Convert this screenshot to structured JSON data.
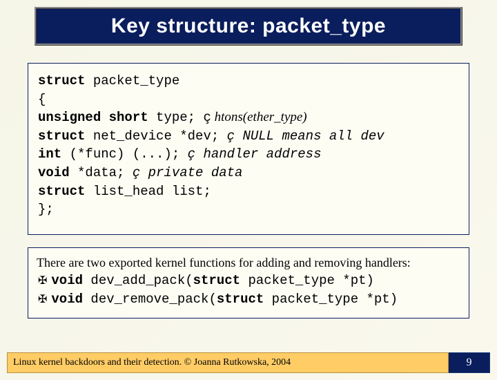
{
  "title": "Key structure: packet_type",
  "code": {
    "l1a": "struct",
    "l1b": " packet_type",
    "l2": "{",
    "l3a": " unsigned short",
    "l3b": "      type;  ",
    "l3c": "ç",
    "l3d": " htons(ether_type)",
    "l4a": " struct",
    "l4b": " net_device *dev;  ",
    "l4c": "ç NULL means all dev",
    "l5a": " int",
    "l5b": " (*func) (...); ",
    "l5c": "ç handler address",
    "l6a": " void",
    "l6b": " *data; ",
    "l6c": "ç private data",
    "l7a": " struct",
    "l7b": " list_head list;",
    "l8": "};"
  },
  "text": {
    "intro": "There are two exported kernel functions for adding and removing handlers:",
    "b1a": "void",
    "b1b": " dev_add_pack(",
    "b1c": "struct",
    "b1d": " packet_type *pt)",
    "b2a": "void",
    "b2b": " dev_remove_pack(",
    "b2c": "struct",
    "b2d": " packet_type *pt)"
  },
  "footer": {
    "left": "Linux kernel backdoors and their detection. © Joanna Rutkowska, 2004",
    "page": "9"
  }
}
